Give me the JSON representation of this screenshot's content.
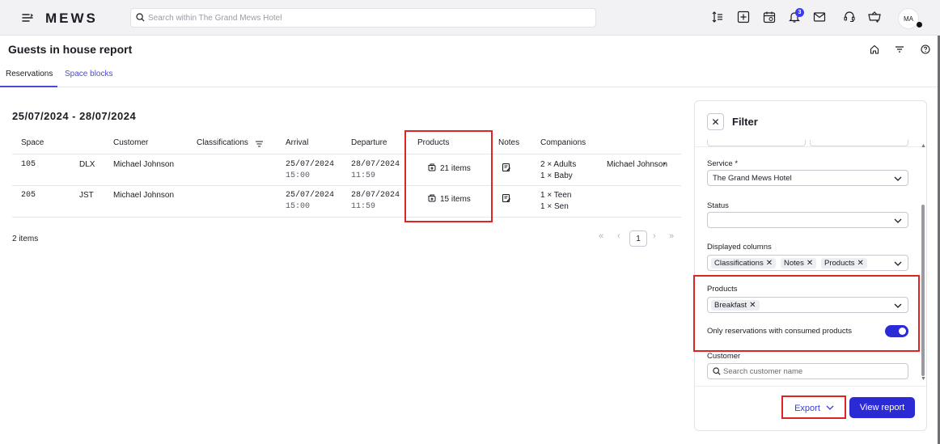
{
  "topbar": {
    "logo": "MEWS",
    "search_placeholder": "Search within The Grand Mews Hotel",
    "notifications_count": "3",
    "avatar_initials": "MA"
  },
  "header": {
    "title": "Guests in house report"
  },
  "tabs": [
    {
      "label": "Reservations",
      "active": true
    },
    {
      "label": "Space blocks",
      "active": false
    }
  ],
  "report": {
    "date_range": "25/07/2024 - 28/07/2024",
    "columns": [
      "Space",
      "Customer",
      "Classifications",
      "Arrival",
      "Departure",
      "Products",
      "Notes",
      "Companions"
    ],
    "rows": [
      {
        "space": "105",
        "space_type": "DLX",
        "customer": "Michael Johnson",
        "arrival_date": "25/07/2024",
        "arrival_time": "15:00",
        "departure_date": "28/07/2024",
        "departure_time": "11:59",
        "products": "21 items",
        "companions_1": "2 × Adults",
        "companions_2": "1 × Baby",
        "companion_name": "Michael Johnson"
      },
      {
        "space": "205",
        "space_type": "JST",
        "customer": "Michael Johnson",
        "arrival_date": "25/07/2024",
        "arrival_time": "15:00",
        "departure_date": "28/07/2024",
        "departure_time": "11:59",
        "products": "15 items",
        "companions_1": "1 × Teen",
        "companions_2": "1 × Sen",
        "companion_name": ""
      }
    ],
    "items_count": "2 items",
    "current_page": "1"
  },
  "filter": {
    "title": "Filter",
    "service_label": "Service *",
    "service_value": "The Grand Mews Hotel",
    "status_label": "Status",
    "status_value": "",
    "displayed_columns_label": "Displayed columns",
    "displayed_columns": [
      "Classifications",
      "Notes",
      "Products"
    ],
    "products_label": "Products",
    "products": [
      "Breakfast"
    ],
    "consumed_toggle_label": "Only reservations with consumed products",
    "consumed_toggle_on": true,
    "customer_label": "Customer",
    "customer_placeholder": "Search customer name",
    "export_label": "Export",
    "view_report_label": "View report"
  },
  "colors": {
    "accent": "#2b2bd6",
    "highlight": "#e02424"
  }
}
